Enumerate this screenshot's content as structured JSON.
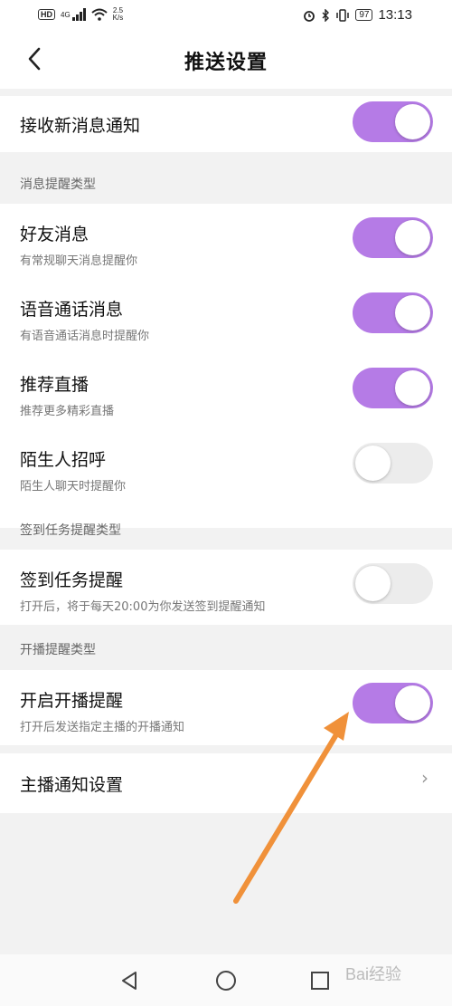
{
  "status_bar": {
    "hd": "HD",
    "net": "4G",
    "speed_value": "2.5",
    "speed_unit": "K/s",
    "battery": "97",
    "time": "13:13"
  },
  "header": {
    "title": "推送设置",
    "back_icon": "chevron-left-icon"
  },
  "main_toggle": {
    "label": "接收新消息通知",
    "on": true
  },
  "sections": [
    {
      "title": "消息提醒类型",
      "items": [
        {
          "label": "好友消息",
          "desc": "有常规聊天消息提醒你",
          "on": true
        },
        {
          "label": "语音通话消息",
          "desc": "有语音通话消息时提醒你",
          "on": true
        },
        {
          "label": "推荐直播",
          "desc": "推荐更多精彩直播",
          "on": true
        },
        {
          "label": "陌生人招呼",
          "desc": "陌生人聊天时提醒你",
          "on": false
        }
      ]
    },
    {
      "title": "签到任务提醒类型",
      "items": [
        {
          "label": "签到任务提醒",
          "desc": "打开后，将于每天20:00为你发送签到提醒通知",
          "on": false
        }
      ]
    },
    {
      "title": "开播提醒类型",
      "items": [
        {
          "label": "开启开播提醒",
          "desc": "打开后发送指定主播的开播通知",
          "on": true
        }
      ]
    }
  ],
  "link_row": {
    "label": "主播通知设置",
    "chevron": "›"
  },
  "watermark": "Bai经验",
  "colors": {
    "toggle_on": "#b57be6",
    "toggle_off": "#ececec",
    "annotation_arrow": "#f0913a"
  }
}
